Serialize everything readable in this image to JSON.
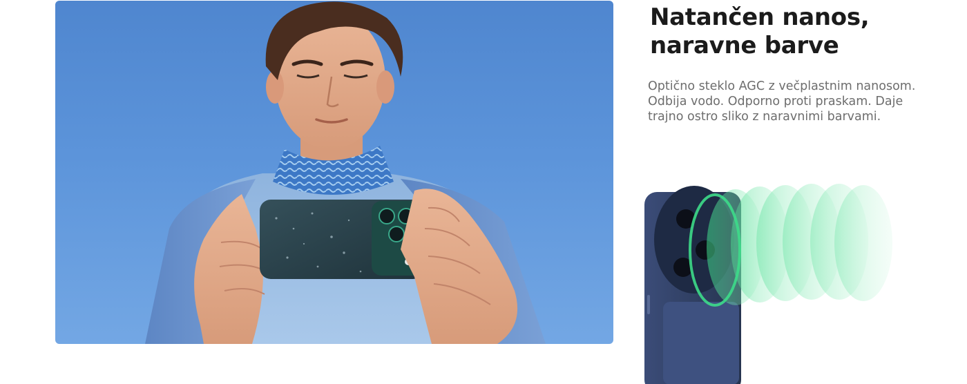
{
  "section": {
    "headline_lines": [
      "Natančen nanos,",
      "naravne barve"
    ],
    "description_lines": [
      "Optično steklo AGC z večplastnim nanosom.",
      "Odbija vodo. Odporno proti praskam. Daje",
      "trajno ostro sliko z naravnimi barvami."
    ]
  },
  "hero_image": {
    "subject": "person-holding-phone-with-case",
    "sky_color": "#5c94da"
  },
  "product_image": {
    "subject": "phone-camera-lens-protector-layers",
    "phone_color": "#2f3f66",
    "lens_glass_color": "#3ddc8a"
  }
}
